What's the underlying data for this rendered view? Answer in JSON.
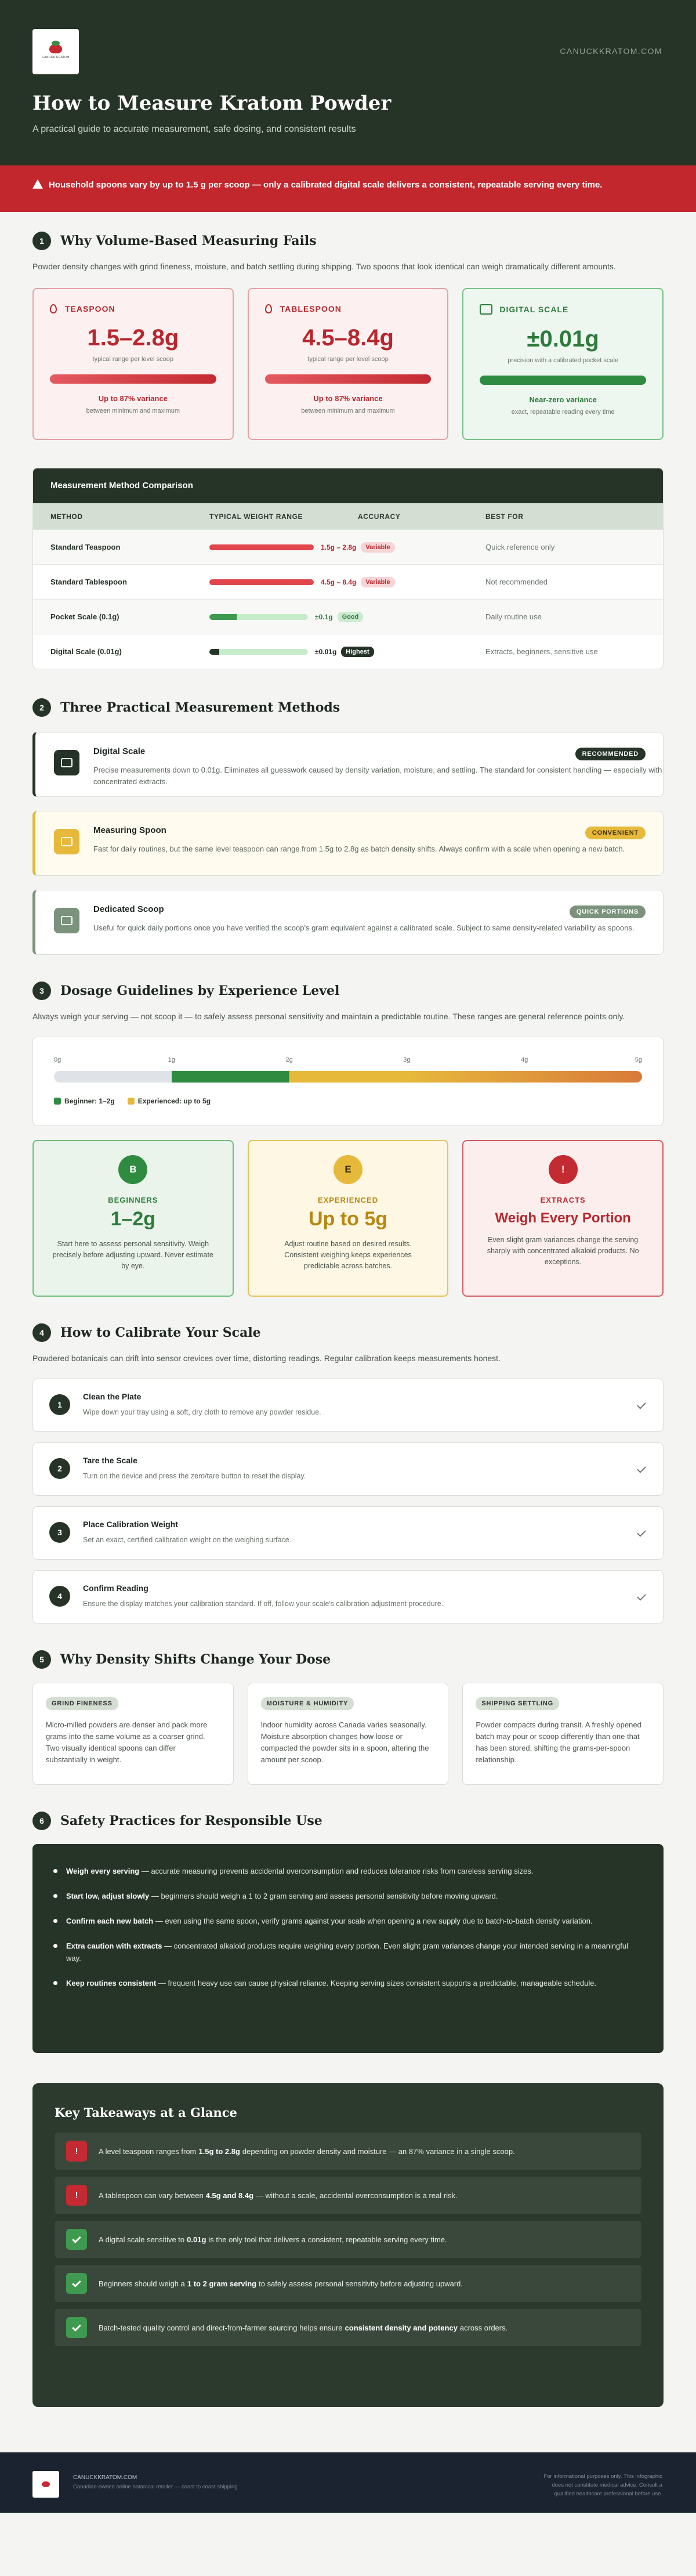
{
  "header": {
    "site": "CANUCKKRATOM.COM",
    "logo_text": "CANUCK KRATOM",
    "title": "How to Measure Kratom Powder",
    "subtitle": "A practical guide to accurate measurement, safe dosing, and consistent results"
  },
  "alert": "Household spoons vary by up to 1.5 g per scoop — only a calibrated digital scale delivers a consistent, repeatable serving every time.",
  "section1": {
    "num": "1",
    "title": "Why Volume-Based Measuring Fails",
    "intro": "Powder density changes with grind fineness, moisture, and batch settling during shipping. Two spoons that look identical can weigh dramatically different amounts.",
    "cards": [
      {
        "label": "TEASPOON",
        "value": "1.5–2.8g",
        "sub": "typical range per level scoop",
        "variance": "Up to 87% variance",
        "variance_sub": "between minimum and maximum"
      },
      {
        "label": "TABLESPOON",
        "value": "4.5–8.4g",
        "sub": "typical range per level scoop",
        "variance": "Up to 87% variance",
        "variance_sub": "between minimum and maximum"
      },
      {
        "label": "DIGITAL SCALE",
        "value": "±0.01g",
        "sub": "precision with a calibrated pocket scale",
        "variance": "Near-zero variance",
        "variance_sub": "exact, repeatable reading every time"
      }
    ],
    "table": {
      "title": "Measurement Method Comparison",
      "headers": [
        "METHOD",
        "TYPICAL WEIGHT RANGE",
        "ACCURACY",
        "BEST FOR"
      ],
      "rows": [
        {
          "method": "Standard Teaspoon",
          "range": "1.5g – 2.8g",
          "accuracy": "Variable",
          "best": "Quick reference only",
          "fill": 0.55
        },
        {
          "method": "Standard Tablespoon",
          "range": "4.5g – 8.4g",
          "accuracy": "Variable",
          "best": "Not recommended",
          "fill": 0.55
        },
        {
          "method": "Pocket Scale (0.1g)",
          "range": "±0.1g",
          "accuracy": "Good",
          "best": "Daily routine use",
          "fill": 0.12
        },
        {
          "method": "Digital Scale (0.01g)",
          "range": "±0.01g",
          "accuracy": "Highest",
          "best": "Extracts, beginners, sensitive use",
          "fill": 0.04
        }
      ]
    }
  },
  "section2": {
    "num": "2",
    "title": "Three Practical Measurement Methods",
    "methods": [
      {
        "title": "Digital Scale",
        "badge": "RECOMMENDED",
        "icon": "scale-icon",
        "desc": "Precise measurements down to 0.01g. Eliminates all guesswork caused by density variation, moisture, and settling. The standard for consistent handling — especially with concentrated extracts."
      },
      {
        "title": "Measuring Spoon",
        "badge": "CONVENIENT",
        "icon": "spoon-icon",
        "desc": "Fast for daily routines, but the same level teaspoon can range from 1.5g to 2.8g as batch density shifts. Always confirm with a scale when opening a new batch."
      },
      {
        "title": "Dedicated Scoop",
        "badge": "QUICK PORTIONS",
        "icon": "scoop-icon",
        "desc": "Useful for quick daily portions once you have verified the scoop's gram equivalent against a calibrated scale. Subject to same density-related variability as spoons."
      }
    ]
  },
  "section3": {
    "num": "3",
    "title": "Dosage Guidelines by Experience Level",
    "intro": "Always weigh your serving — not scoop it — to safely assess personal sensitivity and maintain a predictable routine. These ranges are general reference points only.",
    "ticks": [
      "0g",
      "1g",
      "2g",
      "3g",
      "4g",
      "5g"
    ],
    "legend": [
      {
        "label": "Beginner: 1–2g",
        "color": "#2e8b3f"
      },
      {
        "label": "Experienced: up to 5g",
        "color": "#e6b93b"
      }
    ],
    "cards": [
      {
        "letter": "B",
        "label": "BEGINNERS",
        "value": "1–2g",
        "desc": "Start here to assess personal sensitivity. Weigh precisely before adjusting upward. Never estimate by eye."
      },
      {
        "letter": "E",
        "label": "EXPERIENCED",
        "value": "Up to 5g",
        "desc": "Adjust routine based on desired results. Consistent weighing keeps experiences predictable across batches."
      },
      {
        "letter": "!",
        "label": "EXTRACTS",
        "value": "Weigh Every Portion",
        "desc": "Even slight gram variances change the serving sharply with concentrated alkaloid products. No exceptions."
      }
    ]
  },
  "section4": {
    "num": "4",
    "title": "How to Calibrate Your Scale",
    "intro": "Powdered botanicals can drift into sensor crevices over time, distorting readings. Regular calibration keeps measurements honest.",
    "steps": [
      {
        "n": "1",
        "title": "Clean the Plate",
        "desc": "Wipe down your tray using a soft, dry cloth to remove any powder residue."
      },
      {
        "n": "2",
        "title": "Tare the Scale",
        "desc": "Turn on the device and press the zero/tare button to reset the display."
      },
      {
        "n": "3",
        "title": "Place Calibration Weight",
        "desc": "Set an exact, certified calibration weight on the weighing surface."
      },
      {
        "n": "4",
        "title": "Confirm Reading",
        "desc": "Ensure the display matches your calibration standard. If off, follow your scale's calibration adjustment procedure."
      }
    ]
  },
  "section5": {
    "num": "5",
    "title": "Why Density Shifts Change Your Dose",
    "cards": [
      {
        "tag": "GRIND FINENESS",
        "text": "Micro-milled powders are denser and pack more grams into the same volume as a coarser grind. Two visually identical spoons can differ substantially in weight."
      },
      {
        "tag": "MOISTURE & HUMIDITY",
        "text": "Indoor humidity across Canada varies seasonally. Moisture absorption changes how loose or compacted the powder sits in a spoon, altering the amount per scoop."
      },
      {
        "tag": "SHIPPING SETTLING",
        "text": "Powder compacts during transit. A freshly opened batch may pour or scoop differently than one that has been stored, shifting the grams-per-spoon relationship."
      }
    ]
  },
  "section6": {
    "num": "6",
    "title": "Safety Practices for Responsible Use",
    "items": [
      {
        "bold": "Weigh every serving",
        "text": " — accurate measuring prevents accidental overconsumption and reduces tolerance risks from careless serving sizes."
      },
      {
        "bold": "Start low, adjust slowly",
        "text": " — beginners should weigh a 1 to 2 gram serving and assess personal sensitivity before moving upward."
      },
      {
        "bold": "Confirm each new batch",
        "text": " — even using the same spoon, verify grams against your scale when opening a new supply due to batch-to-batch density variation."
      },
      {
        "bold": "Extra caution with extracts",
        "text": " — concentrated alkaloid products require weighing every portion. Even slight gram variances change your intended serving in a meaningful way."
      },
      {
        "bold": "Keep routines consistent",
        "text": " — frequent heavy use can cause physical reliance. Keeping serving sizes consistent supports a predictable, manageable schedule."
      }
    ]
  },
  "takeaways": {
    "title": "Key Takeaways at a Glance",
    "items": [
      {
        "type": "bad",
        "pre": "A level teaspoon ranges from",
        "bold": "1.5g to 2.8g",
        "post": "depending on powder density and moisture — an 87% variance in a single scoop."
      },
      {
        "type": "bad",
        "pre": "A tablespoon can vary between",
        "bold": "4.5g and 8.4g",
        "post": "— without a scale, accidental overconsumption is a real risk."
      },
      {
        "type": "ok",
        "pre": "A digital scale sensitive to",
        "bold": "0.01g",
        "post": "is the only tool that delivers a consistent, repeatable serving every time."
      },
      {
        "type": "ok",
        "pre": "Beginners should weigh a",
        "bold": "1 to 2 gram serving",
        "post": "to safely assess personal sensitivity before adjusting upward."
      },
      {
        "type": "ok",
        "pre": "Batch-tested quality control and direct-from-farmer sourcing helps ensure",
        "bold": "consistent density and potency",
        "post": "across orders."
      }
    ]
  },
  "footer": {
    "name": "CANUCKKRATOM.COM",
    "sub": "Canadian-owned online botanical retailer — coast to coast shipping",
    "disclaimer": "For informational purposes only. This infographic does not constitute medical advice. Consult a qualified healthcare professional before use."
  }
}
